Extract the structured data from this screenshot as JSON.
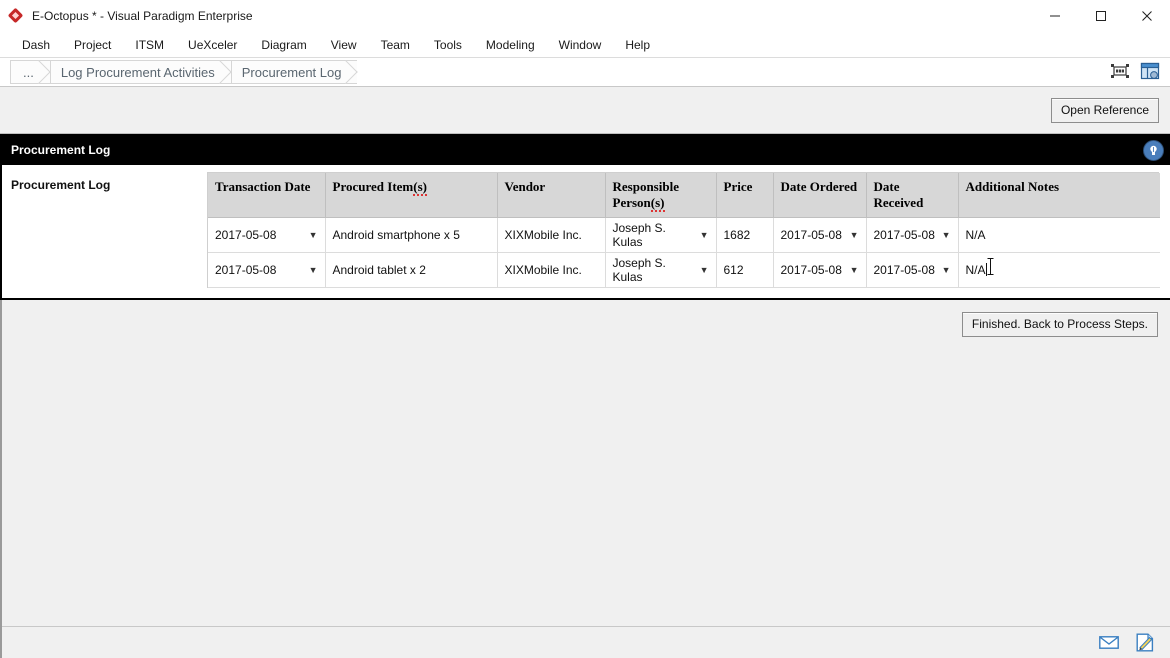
{
  "window": {
    "title": "E-Octopus * - Visual Paradigm Enterprise",
    "logo_icon": "red-diamond-logo",
    "minimize_icon": "minimize-icon",
    "maximize_icon": "maximize-icon",
    "close_icon": "close-icon"
  },
  "menubar": {
    "items": [
      {
        "label": "Dash"
      },
      {
        "label": "Project"
      },
      {
        "label": "ITSM"
      },
      {
        "label": "UeXceler"
      },
      {
        "label": "Diagram"
      },
      {
        "label": "View"
      },
      {
        "label": "Team"
      },
      {
        "label": "Tools"
      },
      {
        "label": "Modeling"
      },
      {
        "label": "Window"
      },
      {
        "label": "Help"
      }
    ]
  },
  "breadcrumb": {
    "items": [
      {
        "label": "..."
      },
      {
        "label": "Log Procurement Activities"
      },
      {
        "label": "Procurement Log"
      }
    ],
    "tools": [
      {
        "icon": "fit-to-screen-icon"
      },
      {
        "icon": "panel-layout-icon"
      }
    ]
  },
  "actionstrip": {
    "open_reference_label": "Open Reference"
  },
  "section": {
    "title": "Procurement Log",
    "help_icon": "lightbulb-help-icon"
  },
  "form": {
    "field_label": "Procurement Log"
  },
  "table": {
    "columns": [
      {
        "label": "Transaction Date"
      },
      {
        "label": "Procured Item(s)",
        "misspelled_part": "(s)"
      },
      {
        "label": "Vendor"
      },
      {
        "label": "Responsible Person(s)",
        "line1": "Responsible",
        "line2": "Person(s)",
        "misspelled_part": "(s)"
      },
      {
        "label": "Price"
      },
      {
        "label": "Date Ordered"
      },
      {
        "label": "Date Received"
      },
      {
        "label": "Additional Notes"
      }
    ],
    "rows": [
      {
        "transaction_date": "2017-05-08",
        "procured_items": "Android smartphone x 5",
        "vendor": "XIXMobile Inc.",
        "responsible_person": "Joseph S. Kulas",
        "price": "1682",
        "date_ordered": "2017-05-08",
        "date_received": "2017-05-08",
        "additional_notes": "N/A"
      },
      {
        "transaction_date": "2017-05-08",
        "procured_items": "Android tablet x 2",
        "vendor": "XIXMobile Inc.",
        "responsible_person": "Joseph S. Kulas",
        "price": "612",
        "date_ordered": "2017-05-08",
        "date_received": "2017-05-08",
        "additional_notes": "N/A"
      }
    ],
    "dropdown_icon": "chevron-down-icon"
  },
  "footer": {
    "finish_button_label": "Finished. Back to Process Steps."
  },
  "statusbar": {
    "icons": [
      {
        "icon": "mail-envelope-icon"
      },
      {
        "icon": "document-edit-icon"
      }
    ]
  }
}
